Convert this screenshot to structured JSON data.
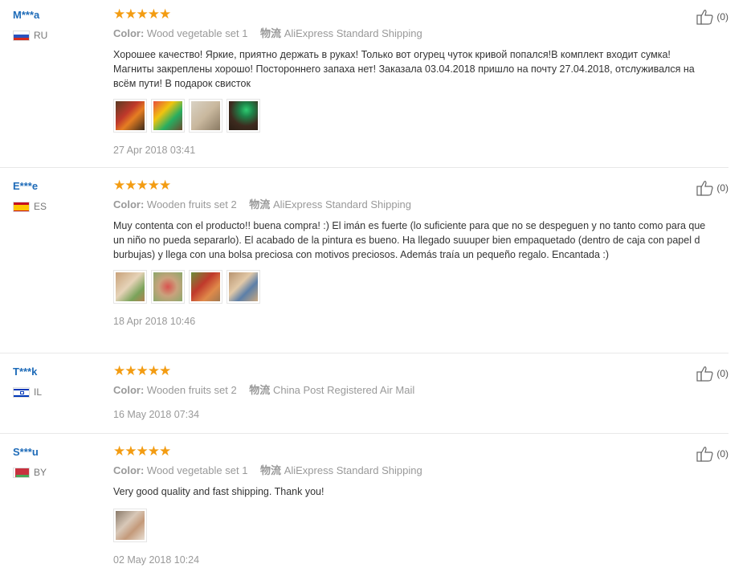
{
  "labels": {
    "color": "Color:",
    "shipping": "物流"
  },
  "reviews": [
    {
      "user": "M***a",
      "country": "RU",
      "stars": 5,
      "color": "Wood vegetable set 1",
      "shipping": "AliExpress Standard Shipping",
      "text": "Хорошее качество! Яркие, приятно держать в руках! Только вот огурец чуток кривой попался!В комплект входит сумка! Магниты закреплены хорошо! Постороннего запаха нет! Заказала 03.04.2018 пришло на почту 27.04.2018, отслуживался на всём пути! В подарок свисток",
      "thumbnails": 4,
      "date": "27 Apr 2018 03:41",
      "helpful": "(0)"
    },
    {
      "user": "E***e",
      "country": "ES",
      "stars": 5,
      "color": "Wooden fruits set 2",
      "shipping": "AliExpress Standard Shipping",
      "text": "Muy contenta con el producto!! buena compra! :) El imán es fuerte (lo suficiente para que no se despeguen y no tanto como para que un niño no pueda separarlo). El acabado de la pintura es bueno. Ha llegado suuuper bien empaquetado (dentro de caja con papel d burbujas) y llega con una bolsa preciosa con motivos preciosos. Además traía un pequeño regalo. Encantada :)",
      "thumbnails": 4,
      "date": "18 Apr 2018 10:46",
      "helpful": "(0)"
    },
    {
      "user": "T***k",
      "country": "IL",
      "stars": 5,
      "color": "Wooden fruits set 2",
      "shipping": "China Post Registered Air Mail",
      "text": "",
      "thumbnails": 0,
      "date": "16 May 2018 07:34",
      "helpful": "(0)"
    },
    {
      "user": "S***u",
      "country": "BY",
      "stars": 5,
      "color": "Wood vegetable set 1",
      "shipping": "AliExpress Standard Shipping",
      "text": "Very good quality and fast shipping. Thank you!",
      "thumbnails": 1,
      "date": "02 May 2018 10:24",
      "helpful": "(0)"
    }
  ],
  "colors": {
    "star": "#f39c12",
    "username": "#1e6bb8",
    "meta": "#999999"
  }
}
